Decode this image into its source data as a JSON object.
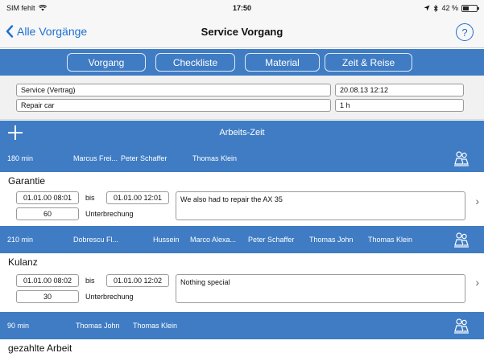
{
  "status_bar": {
    "carrier": "SIM fehlt",
    "wifi_icon": "wifi-icon",
    "time": "17:50",
    "battery_text": "42 %",
    "battery_level": 0.42
  },
  "nav": {
    "back_label": "Alle Vorgänge",
    "title": "Service Vorgang",
    "help_label": "?"
  },
  "segments": [
    "Vorgang",
    "Checkliste",
    "Material",
    "Zeit & Reise"
  ],
  "header": {
    "service_type": "Service (Vertrag)",
    "date": "20.08.13 12:12",
    "description": "Repair car",
    "duration": "1 h"
  },
  "arbeits_zeit": {
    "add_icon": "plus-icon",
    "title": "Arbeits-Zeit"
  },
  "entries": [
    {
      "minutes": "180 min",
      "workers": [
        "Marcus Frei...",
        "Peter Schaffer",
        "Thomas Klein"
      ],
      "title": "Garantie",
      "from": "01.01.00 08:01",
      "bis_label": "bis",
      "to": "01.01.00 12:01",
      "pause": "60",
      "pause_label": "Unterbrechung",
      "note": "We also had to repair the AX 35"
    },
    {
      "minutes": "210 min",
      "workers": [
        "Dobrescu Fl...",
        "Hussein",
        "Marco Alexa...",
        "Peter Schaffer",
        "Thomas John",
        "Thomas Klein"
      ],
      "title": "Kulanz",
      "from": "01.01.00 08:02",
      "bis_label": "bis",
      "to": "01.01.00 12:02",
      "pause": "30",
      "pause_label": "Unterbrechung",
      "note": "Nothing special"
    },
    {
      "minutes": "90 min",
      "workers": [
        "Thomas John",
        "Thomas Klein"
      ],
      "title": "gezahlte Arbeit"
    }
  ],
  "icons": {
    "chevron": "chevron-right-icon",
    "workers": "workers-icon"
  }
}
